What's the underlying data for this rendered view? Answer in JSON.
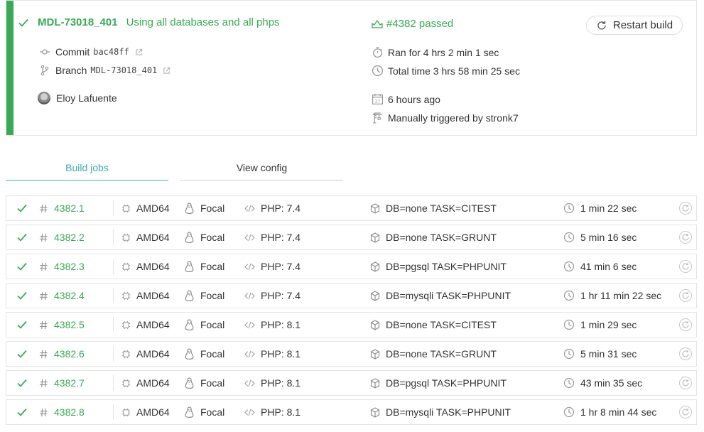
{
  "colors": {
    "passed": "#39aa56",
    "tab_active": "#3eaaaf",
    "border": "#e4e4e4"
  },
  "build": {
    "branch": "MDL-73018_401",
    "commit_message": "Using all databases and all phps",
    "status": "#4382 passed",
    "restart_label": "Restart build",
    "commit_label": "Commit",
    "commit_sha": "bac48ff",
    "branch_label": "Branch",
    "branch_ref": "MDL-73018_401",
    "author": "Eloy Lafuente",
    "ran_for": "Ran for 4 hrs 2 min 1 sec",
    "total_time": "Total time 3 hrs 58 min 25 sec",
    "finished": "6 hours ago",
    "trigger": "Manually triggered by stronk7"
  },
  "tabs": [
    {
      "label": "Build jobs",
      "active": true
    },
    {
      "label": "View config",
      "active": false
    }
  ],
  "jobs": [
    {
      "number": "4382.1",
      "arch": "AMD64",
      "os": "Focal",
      "language": "PHP: 7.4",
      "env": "DB=none TASK=CITEST",
      "duration": "1 min 22 sec",
      "state": "passed"
    },
    {
      "number": "4382.2",
      "arch": "AMD64",
      "os": "Focal",
      "language": "PHP: 7.4",
      "env": "DB=none TASK=GRUNT",
      "duration": "5 min 16 sec",
      "state": "passed"
    },
    {
      "number": "4382.3",
      "arch": "AMD64",
      "os": "Focal",
      "language": "PHP: 7.4",
      "env": "DB=pgsql TASK=PHPUNIT",
      "duration": "41 min 6 sec",
      "state": "passed"
    },
    {
      "number": "4382.4",
      "arch": "AMD64",
      "os": "Focal",
      "language": "PHP: 7.4",
      "env": "DB=mysqli TASK=PHPUNIT",
      "duration": "1 hr 11 min 22 sec",
      "state": "passed"
    },
    {
      "number": "4382.5",
      "arch": "AMD64",
      "os": "Focal",
      "language": "PHP: 8.1",
      "env": "DB=none TASK=CITEST",
      "duration": "1 min 29 sec",
      "state": "passed"
    },
    {
      "number": "4382.6",
      "arch": "AMD64",
      "os": "Focal",
      "language": "PHP: 8.1",
      "env": "DB=none TASK=GRUNT",
      "duration": "5 min 31 sec",
      "state": "passed"
    },
    {
      "number": "4382.7",
      "arch": "AMD64",
      "os": "Focal",
      "language": "PHP: 8.1",
      "env": "DB=pgsql TASK=PHPUNIT",
      "duration": "43 min 35 sec",
      "state": "passed"
    },
    {
      "number": "4382.8",
      "arch": "AMD64",
      "os": "Focal",
      "language": "PHP: 8.1",
      "env": "DB=mysqli TASK=PHPUNIT",
      "duration": "1 hr 8 min 44 sec",
      "state": "passed"
    }
  ]
}
